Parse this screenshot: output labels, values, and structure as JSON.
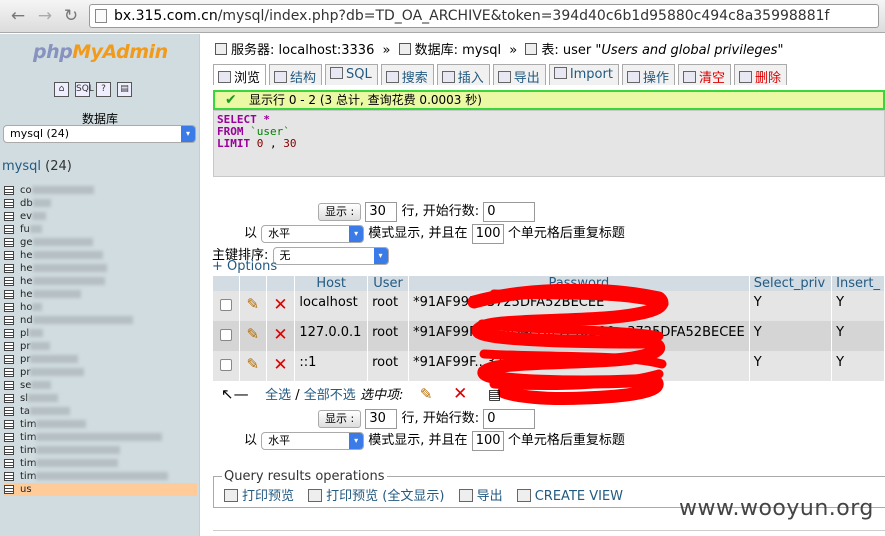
{
  "browser": {
    "url_host": "bx.315.com.cn",
    "url_path": "/mysql/index.php?db=TD_OA_ARCHIVE&token=394d40c6b1d95880c494c8a35998881f"
  },
  "sidebar": {
    "logo_php": "php",
    "logo_my": "My",
    "logo_admin": "Admin",
    "db_label": "数据库",
    "db_select": "mysql (24)",
    "db_title": "mysql",
    "db_count": "(24)",
    "tables": [
      {
        "name": "co",
        "active": false
      },
      {
        "name": "db",
        "active": false
      },
      {
        "name": "ev",
        "active": false
      },
      {
        "name": "fu",
        "active": false
      },
      {
        "name": "ge",
        "active": false
      },
      {
        "name": "he",
        "active": false
      },
      {
        "name": "he",
        "active": false
      },
      {
        "name": "he",
        "active": false
      },
      {
        "name": "he",
        "active": false
      },
      {
        "name": "ho",
        "active": false
      },
      {
        "name": "nd",
        "active": false
      },
      {
        "name": "pl",
        "active": false
      },
      {
        "name": "pr",
        "active": false
      },
      {
        "name": "pr",
        "active": false
      },
      {
        "name": "pr",
        "active": false
      },
      {
        "name": "se",
        "active": false
      },
      {
        "name": "sl",
        "active": false
      },
      {
        "name": "ta",
        "active": false
      },
      {
        "name": "tim",
        "active": false
      },
      {
        "name": "tim",
        "active": false
      },
      {
        "name": "tim",
        "active": false
      },
      {
        "name": "tim",
        "active": false
      },
      {
        "name": "tim",
        "active": false
      },
      {
        "name": "us",
        "active": true
      }
    ]
  },
  "breadcrumb": {
    "server_label": "服务器:",
    "server": "localhost:3336",
    "db_label": "数据库:",
    "db": "mysql",
    "table_label": "表:",
    "table": "user",
    "comment": "\"Users and global privileges\""
  },
  "tabs": [
    {
      "label": "浏览",
      "state": "active"
    },
    {
      "label": "结构",
      "state": "normal"
    },
    {
      "label": "SQL",
      "state": "normal"
    },
    {
      "label": "搜索",
      "state": "normal"
    },
    {
      "label": "插入",
      "state": "normal"
    },
    {
      "label": "导出",
      "state": "normal"
    },
    {
      "label": "Import",
      "state": "normal"
    },
    {
      "label": "操作",
      "state": "normal"
    },
    {
      "label": "清空",
      "state": "danger"
    },
    {
      "label": "删除",
      "state": "danger"
    }
  ],
  "message": "显示行 0 - 2 (3 总计, 查询花费 0.0003 秒)",
  "sql": {
    "select": "SELECT",
    "star": "*",
    "from": "FROM",
    "table": "`user`",
    "limit": "LIMIT",
    "offset": "0",
    "comma": ",",
    "count": "30"
  },
  "navigation": {
    "show_button": "显示 :",
    "rows": "30",
    "start_label": "行, 开始行数:",
    "start": "0",
    "with_label": "以",
    "mode": "水平",
    "mode_suffix": "模式显示, 并且在",
    "repeat": "100",
    "repeat_suffix": "个单元格后重复标题"
  },
  "sort": {
    "label": "主键排序:",
    "value": "无"
  },
  "options_link": "+ Options",
  "table": {
    "headers": [
      "Host",
      "User",
      "Password",
      "Select_priv",
      "Insert_"
    ],
    "rows": [
      {
        "host": "localhost",
        "user": "root",
        "password": "*91AF99F...3725DFA52BECEE",
        "select_priv": "Y",
        "insert_priv": "Y"
      },
      {
        "host": "127.0.0.1",
        "user": "root",
        "password": "*91AF99F25C5D4ED05148D10...3725DFA52BECEE",
        "select_priv": "Y",
        "insert_priv": "Y"
      },
      {
        "host": "::1",
        "user": "root",
        "password": "*91AF99F...3725DFA52BECEE",
        "select_priv": "Y",
        "insert_priv": "Y"
      }
    ]
  },
  "bulk": {
    "check_all": "全选",
    "slash": "/",
    "uncheck_all": "全部不选",
    "selected_label": "选中项:"
  },
  "query_ops": {
    "legend": "Query results operations",
    "links": [
      "打印预览",
      "打印预览 (全文显示)",
      "导出",
      "CREATE VIEW"
    ]
  },
  "watermark": "www.wooyun.org",
  "colors": {
    "link": "#235a81",
    "success_border": "#3bd63b",
    "success_bg": "#ebf8a4",
    "redaction": "#ff0000"
  }
}
